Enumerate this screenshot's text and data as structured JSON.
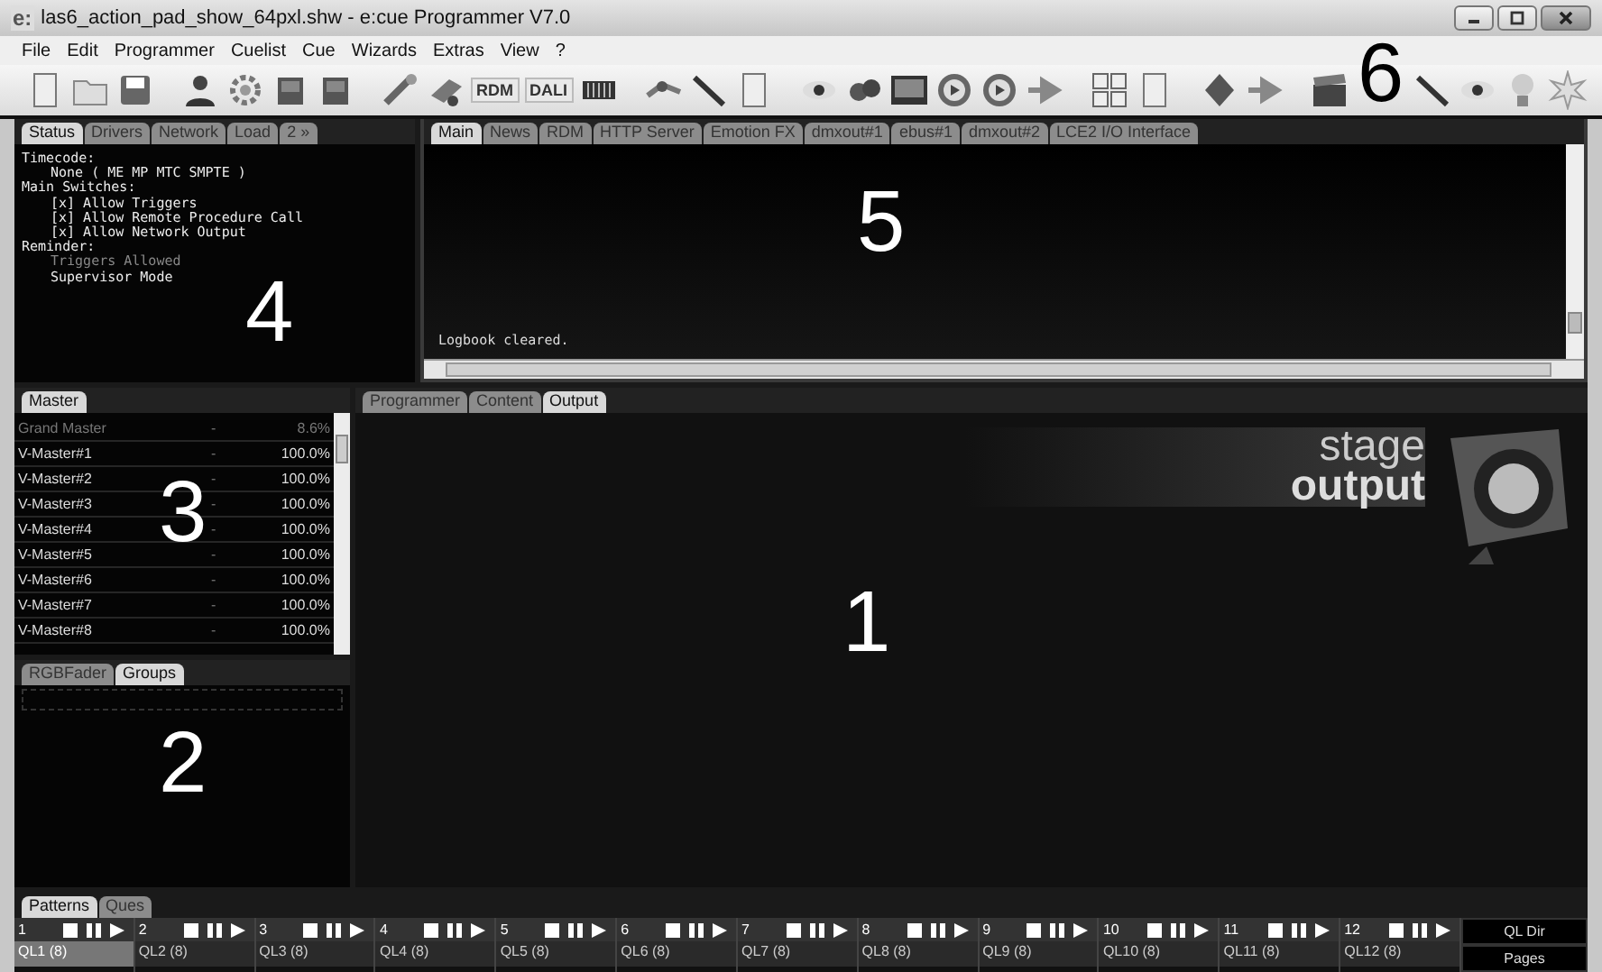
{
  "window": {
    "title": "las6_action_pad_show_64pxl.shw - e:cue Programmer V7.0",
    "app_badge": "e:"
  },
  "menu": [
    "File",
    "Edit",
    "Programmer",
    "Cuelist",
    "Cue",
    "Wizards",
    "Extras",
    "View",
    "?"
  ],
  "toolbar": {
    "text_buttons": [
      "RDM",
      "DALI"
    ],
    "callout": "6"
  },
  "status_panel": {
    "tabs": [
      {
        "label": "Status",
        "selected": true
      },
      {
        "label": "Drivers",
        "selected": false
      },
      {
        "label": "Network",
        "selected": false
      },
      {
        "label": "Load",
        "selected": false
      },
      {
        "label": "2 »",
        "selected": false
      }
    ],
    "lines": [
      {
        "text": "Timecode:",
        "children": [
          {
            "text": "None ( ME MP MTC SMPTE )",
            "dimmed": false
          }
        ]
      },
      {
        "text": "Main Switches:",
        "children": [
          {
            "text": "[x] Allow Triggers",
            "dimmed": false
          },
          {
            "text": "[x] Allow Remote Procedure Call",
            "dimmed": false
          },
          {
            "text": "[x] Allow Network Output",
            "dimmed": false
          }
        ]
      },
      {
        "text": "Reminder:",
        "children": [
          {
            "text": "Triggers Allowed",
            "dimmed": true
          },
          {
            "text": "Supervisor Mode",
            "dimmed": false
          }
        ]
      }
    ],
    "callout": "4"
  },
  "logbook": {
    "tabs": [
      {
        "label": "Main",
        "selected": true
      },
      {
        "label": "News",
        "selected": false
      },
      {
        "label": "RDM",
        "selected": false
      },
      {
        "label": "HTTP Server",
        "selected": false
      },
      {
        "label": "Emotion FX",
        "selected": false
      },
      {
        "label": "dmxout#1",
        "selected": false
      },
      {
        "label": "ebus#1",
        "selected": false
      },
      {
        "label": "dmxout#2",
        "selected": false
      },
      {
        "label": "LCE2 I/O Interface",
        "selected": false
      }
    ],
    "message": "Logbook cleared.",
    "callout": "5"
  },
  "master_panel": {
    "tabs": [
      {
        "label": "Master",
        "selected": true
      }
    ],
    "rows": [
      {
        "name": "Grand Master",
        "dash": "-",
        "value": "8.6%",
        "dimmed": true
      },
      {
        "name": "V-Master#1",
        "dash": "-",
        "value": "100.0%",
        "dimmed": false
      },
      {
        "name": "V-Master#2",
        "dash": "-",
        "value": "100.0%",
        "dimmed": false
      },
      {
        "name": "V-Master#3",
        "dash": "-",
        "value": "100.0%",
        "dimmed": false
      },
      {
        "name": "V-Master#4",
        "dash": "-",
        "value": "100.0%",
        "dimmed": false
      },
      {
        "name": "V-Master#5",
        "dash": "-",
        "value": "100.0%",
        "dimmed": false
      },
      {
        "name": "V-Master#6",
        "dash": "-",
        "value": "100.0%",
        "dimmed": false
      },
      {
        "name": "V-Master#7",
        "dash": "-",
        "value": "100.0%",
        "dimmed": false
      },
      {
        "name": "V-Master#8",
        "dash": "-",
        "value": "100.0%",
        "dimmed": false
      }
    ],
    "callout": "3"
  },
  "groups_panel": {
    "tabs": [
      {
        "label": "RGBFader",
        "selected": false
      },
      {
        "label": "Groups",
        "selected": true
      }
    ],
    "callout": "2"
  },
  "output_panel": {
    "tabs": [
      {
        "label": "Programmer",
        "selected": false
      },
      {
        "label": "Content",
        "selected": false
      },
      {
        "label": "Output",
        "selected": true
      }
    ],
    "logo_top": "stage",
    "logo_bottom": "output",
    "callout": "1"
  },
  "cuelist_bar": {
    "tabs": [
      {
        "label": "Patterns",
        "selected": true
      },
      {
        "label": "Ques",
        "selected": false
      }
    ],
    "slots": [
      {
        "number": "1",
        "label": "QL1 (8)",
        "selected": true
      },
      {
        "number": "2",
        "label": "QL2 (8)",
        "selected": false
      },
      {
        "number": "3",
        "label": "QL3 (8)",
        "selected": false
      },
      {
        "number": "4",
        "label": "QL4 (8)",
        "selected": false
      },
      {
        "number": "5",
        "label": "QL5 (8)",
        "selected": false
      },
      {
        "number": "6",
        "label": "QL6 (8)",
        "selected": false
      },
      {
        "number": "7",
        "label": "QL7 (8)",
        "selected": false
      },
      {
        "number": "8",
        "label": "QL8 (8)",
        "selected": false
      },
      {
        "number": "9",
        "label": "QL9 (8)",
        "selected": false
      },
      {
        "number": "10",
        "label": "QL10 (8)",
        "selected": false
      },
      {
        "number": "11",
        "label": "QL11 (8)",
        "selected": false
      },
      {
        "number": "12",
        "label": "QL12 (8)",
        "selected": false
      }
    ],
    "side_buttons": [
      "QL Dir",
      "Pages"
    ]
  }
}
